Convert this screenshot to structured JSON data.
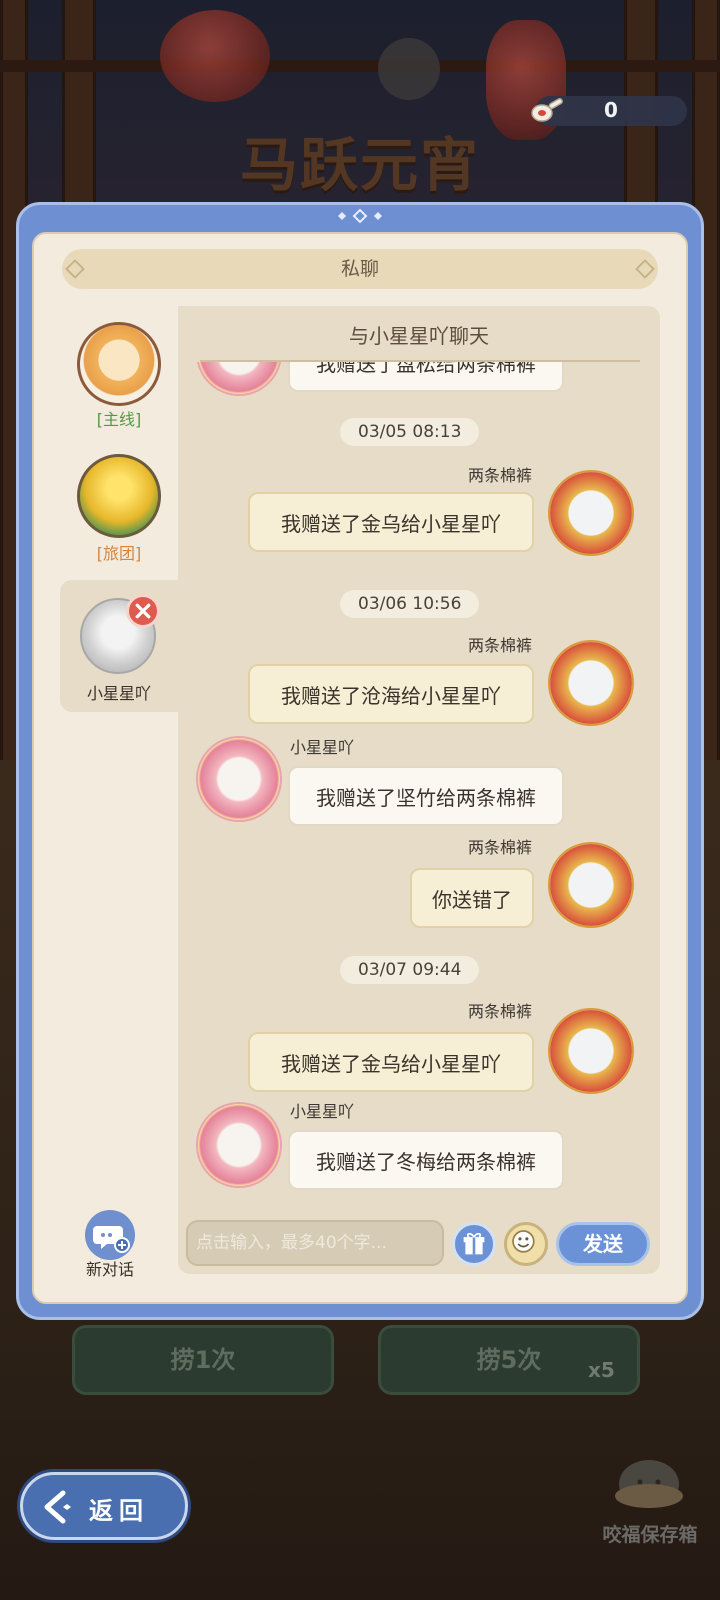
{
  "event": {
    "title": "马跃元宵",
    "currency_value": "0"
  },
  "modal": {
    "header": "私聊",
    "sidebar": [
      {
        "label": "[主线]",
        "color": "#4f9a44"
      },
      {
        "label": "[旅团]",
        "color": "#d9843a"
      },
      {
        "label": "小星星吖",
        "color": "#3b3028"
      }
    ],
    "new_chat_label": "新对话",
    "chat": {
      "title": "与小星星吖聊天",
      "messages": [
        {
          "sender": "self",
          "name": "两条棉裤",
          "text": "我赠送了金乌给小星星吖",
          "timestamp": "03/05  08:13"
        },
        {
          "sender": "self",
          "name": "两条棉裤",
          "text": "我赠送了沧海给小星星吖",
          "timestamp": "03/06  10:56"
        },
        {
          "sender": "other",
          "name": "小星星吖",
          "text": "我赠送了坚竹给两条棉裤"
        },
        {
          "sender": "self",
          "name": "两条棉裤",
          "text": "你送错了"
        },
        {
          "sender": "self",
          "name": "两条棉裤",
          "text": "我赠送了金乌给小星星吖",
          "timestamp": "03/07  09:44"
        },
        {
          "sender": "other",
          "name": "小星星吖",
          "text": "我赠送了冬梅给两条棉裤"
        }
      ],
      "partial_top_message": "我赠送了盘松给两条棉裤"
    },
    "input_placeholder": "点击输入，最多40个字...",
    "send_label": "发送"
  },
  "bottom": {
    "draw_once": "捞1次",
    "draw_five": "捞5次",
    "draw_five_badge": "x5",
    "storage_label": "咬福保存箱",
    "back_label": "返回"
  },
  "colors": {
    "accent_blue": "#6b92d6",
    "panel_cream": "#f3ecde"
  }
}
